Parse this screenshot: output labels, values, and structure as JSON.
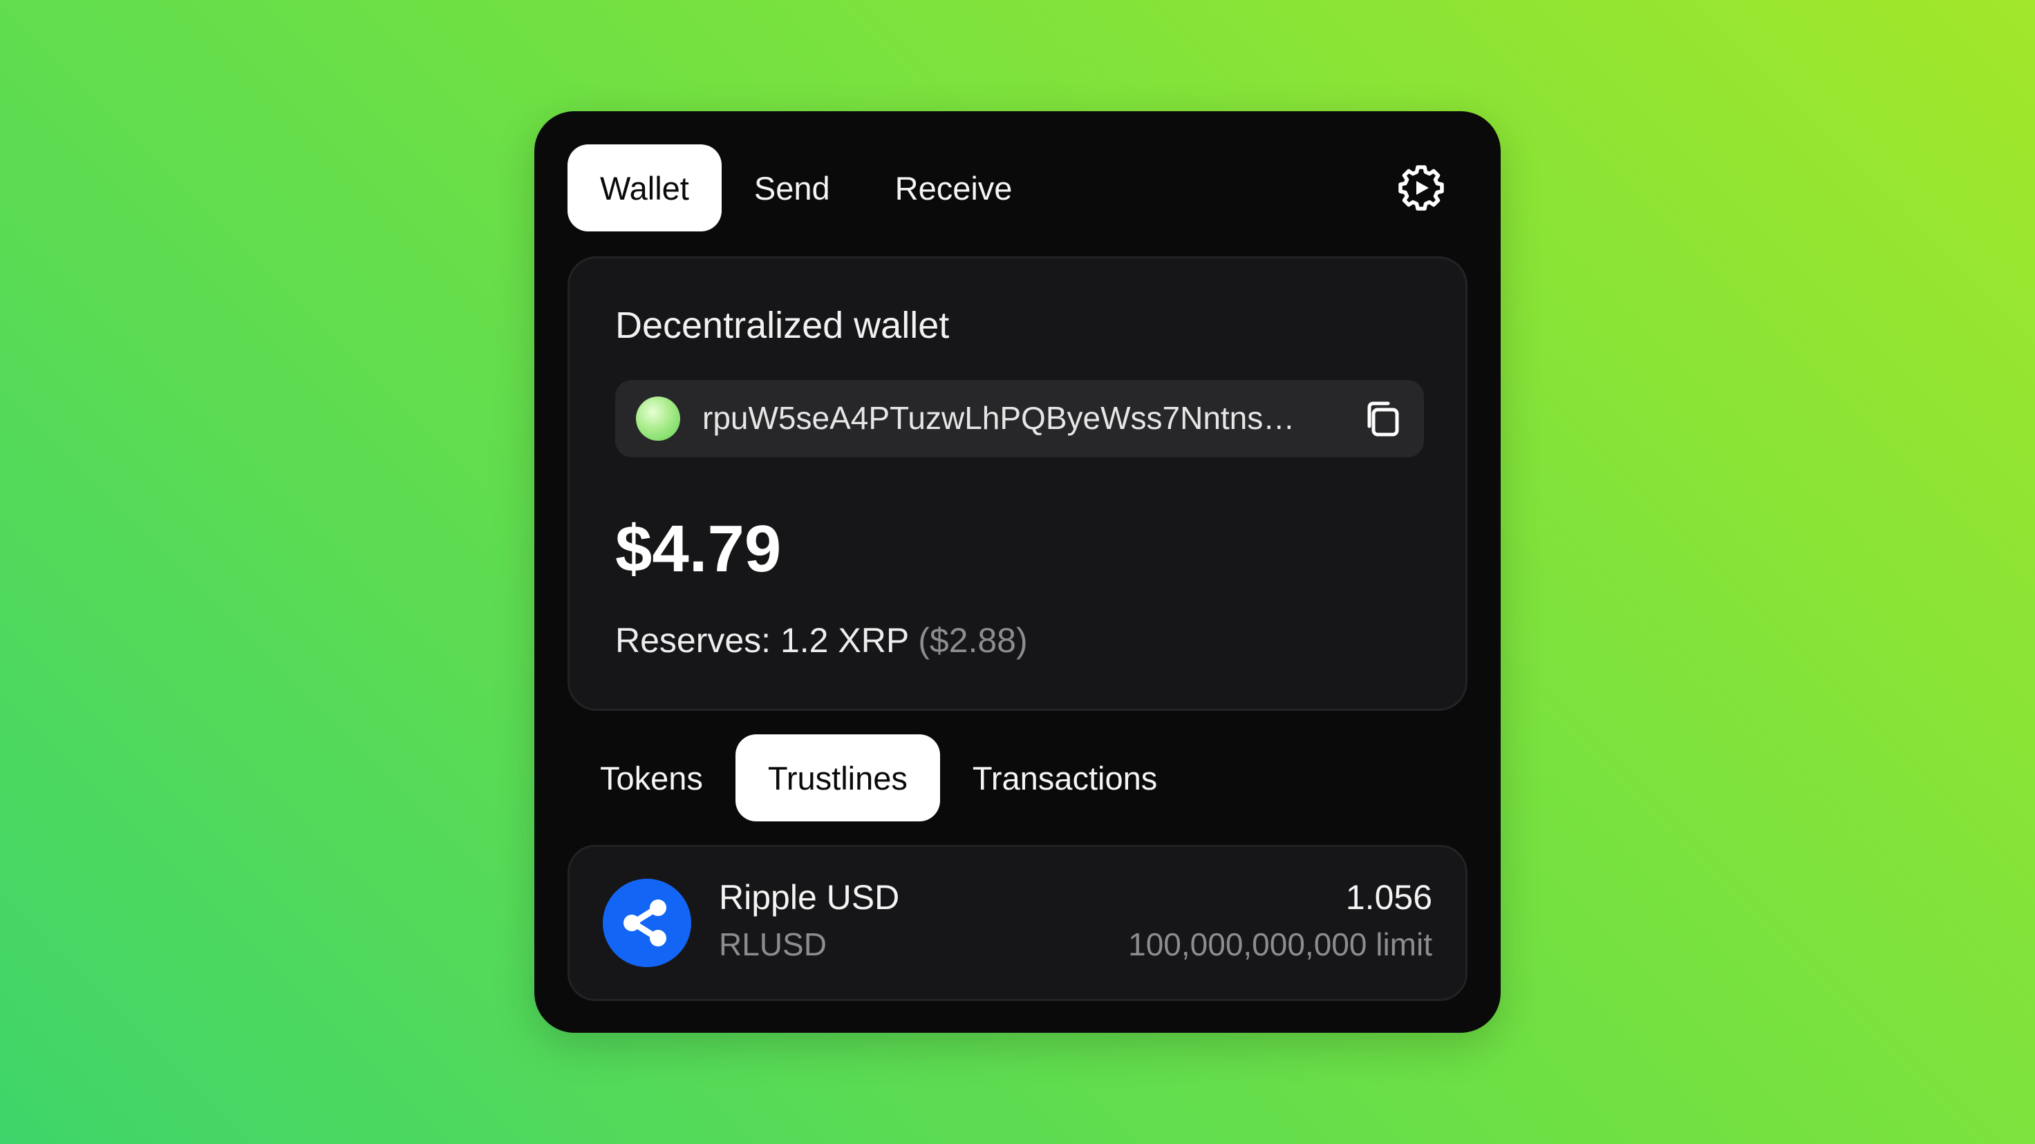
{
  "nav": {
    "tabs": [
      {
        "label": "Wallet",
        "active": true
      },
      {
        "label": "Send",
        "active": false
      },
      {
        "label": "Receive",
        "active": false
      }
    ],
    "settings_icon": "gear-icon"
  },
  "wallet": {
    "title": "Decentralized wallet",
    "address": "rpuW5seA4PTuzwLhPQByeWss7Nntns…",
    "balance": "$4.79",
    "reserves_label": "Reserves: 1.2 XRP",
    "reserves_usd": "($2.88)"
  },
  "subtabs": [
    {
      "label": "Tokens",
      "active": false
    },
    {
      "label": "Trustlines",
      "active": true
    },
    {
      "label": "Transactions",
      "active": false
    }
  ],
  "trustlines": [
    {
      "name": "Ripple USD",
      "symbol": "RLUSD",
      "amount": "1.056",
      "limit": "100,000,000,000 limit",
      "icon": "ripple-logo-icon",
      "color": "#1366f5"
    }
  ],
  "colors": {
    "card_bg": "#0a0a0b",
    "panel_bg": "#161618",
    "muted_text": "#8c8c91",
    "accent_blue": "#1366f5"
  }
}
